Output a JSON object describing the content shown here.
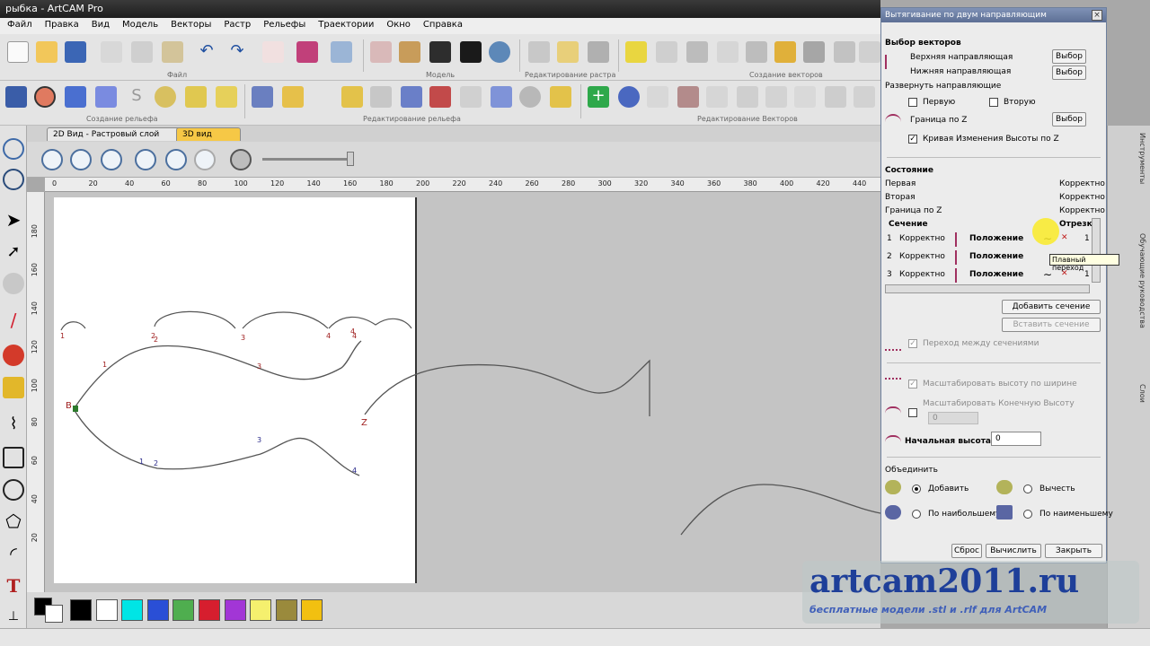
{
  "window": {
    "title": "рыбка - ArtCAM Pro"
  },
  "menu": [
    "Файл",
    "Правка",
    "Вид",
    "Модель",
    "Векторы",
    "Растр",
    "Рельефы",
    "Траектории",
    "Окно",
    "Справка"
  ],
  "toolbar_groups": {
    "file": "Файл",
    "model": "Модель",
    "raster_edit": "Редактирование растра",
    "vector_create": "Создание векторов",
    "relief_create": "Создание рельефа",
    "relief_edit": "Редактирование рельефа",
    "vector_edit": "Редактирование Векторов"
  },
  "tabs": {
    "view2d": "2D Вид - Растровый слой",
    "view3d": "3D вид",
    "close": "×"
  },
  "rulers": {
    "top": [
      "0",
      "20",
      "40",
      "60",
      "80",
      "100",
      "120",
      "140",
      "160",
      "180",
      "200",
      "220",
      "240",
      "260",
      "280",
      "300",
      "320",
      "340",
      "360",
      "380",
      "400",
      "420",
      "440"
    ],
    "left": [
      "180",
      "160",
      "140",
      "120",
      "100",
      "80",
      "60",
      "40",
      "20"
    ]
  },
  "canvas_labels": {
    "b": "B",
    "z": "Z",
    "upper": [
      "1",
      "2",
      "3",
      "4"
    ],
    "lower": [
      "1",
      "2",
      "3",
      "4"
    ],
    "top_curves": [
      "1",
      "2",
      "3",
      "4",
      "4"
    ]
  },
  "panel": {
    "title": "Вытягивание по двум направляющим",
    "close": "×",
    "vector_select": "Выбор векторов",
    "upper_guide": "Верхняя направляющая",
    "lower_guide": "Нижняя направляющая",
    "select_btn": "Выбор",
    "reverse": "Развернуть направляющие",
    "first": "Первую",
    "second": "Вторую",
    "z_boundary": "Граница по Z",
    "height_curve": "Кривая Изменения Высоты по Z",
    "state": "Состояние",
    "state_rows": [
      {
        "name": "Первая",
        "value": "Корректно"
      },
      {
        "name": "Вторая",
        "value": "Корректно"
      },
      {
        "name": "Граница по Z",
        "value": "Корректно"
      }
    ],
    "section": "Сечение",
    "segment": "Отрезк",
    "sections": [
      {
        "num": "1",
        "state": "Корректно",
        "pos": "Положение",
        "seg": "1"
      },
      {
        "num": "2",
        "state": "Корректно",
        "pos": "Положение",
        "seg": "1"
      },
      {
        "num": "3",
        "state": "Корректно",
        "pos": "Положение",
        "seg": "1"
      }
    ],
    "tooltip": "Плавный переход",
    "add_section": "Добавить сечение",
    "insert_section": "Вставить сечение",
    "transition": "Переход между сечениями",
    "scale_height": "Масштабировать высоту по ширине",
    "scale_final": "Масштабировать Конечную Высоту",
    "final_value": "0",
    "start_height": "Начальная высота",
    "start_value": "0",
    "combine": "Объединить",
    "add": "Добавить",
    "subtract": "Вычесть",
    "highest": "По наибольшему",
    "lowest": "По наименьшему",
    "reset": "Сброс",
    "calculate": "Вычислить",
    "close_btn": "Закрыть"
  },
  "right_strip": [
    "Инструменты",
    "Обучающие руководства",
    "Слои"
  ],
  "palette": [
    "#000000",
    "#ffffff",
    "#00e5e5",
    "#2a4fd6",
    "#4fae4f",
    "#d61e2e",
    "#a236d6",
    "#f5f06e",
    "#9a8a3c",
    "#f2c010"
  ],
  "watermark": {
    "title": "artcam2011.ru",
    "subtitle": "бесплатные модели .stl и .rlf для ArtCAM"
  },
  "icons": [
    "select-arrow-icon",
    "node-edit-icon",
    "transform-icon",
    "pencil-icon",
    "paint-icon",
    "eraser-icon",
    "polyline-icon",
    "rectangle-icon",
    "circle-icon",
    "polygon-icon",
    "arc-icon",
    "text-icon",
    "zoom-in-icon",
    "zoom-out-icon",
    "zoom-fit-icon",
    "gear-icon"
  ]
}
